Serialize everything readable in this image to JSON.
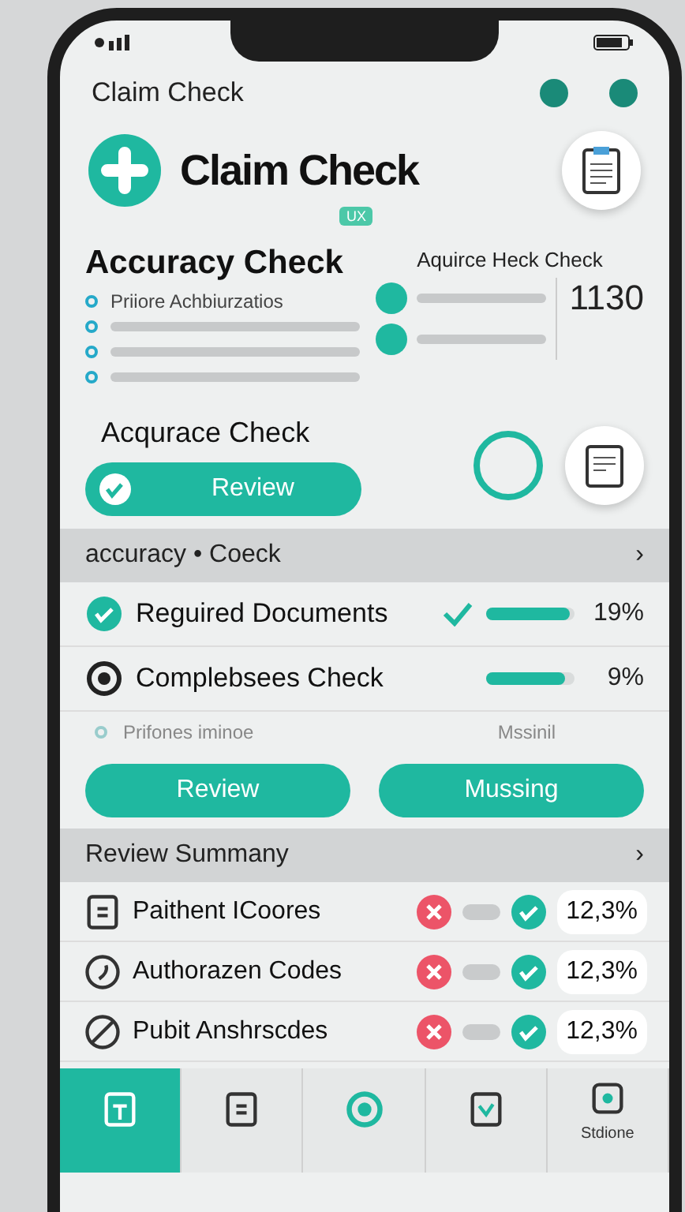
{
  "app_bar": {
    "title": "Claim Check"
  },
  "brand": {
    "title": "Claim Check",
    "tag": "UX"
  },
  "accuracy": {
    "title": "Accuracy Check",
    "items": [
      {
        "kind": "text",
        "label": "Priiore Achbiurzatios"
      },
      {
        "kind": "bar"
      },
      {
        "kind": "bar"
      },
      {
        "kind": "bar"
      }
    ]
  },
  "summary_card": {
    "title": "Aquirce Heck Check",
    "value": "1130"
  },
  "review_block": {
    "title": "Acqurace Check",
    "button": "Review"
  },
  "checks_section": {
    "title": "accuracy • Coeck",
    "chevron": "›",
    "rows": [
      {
        "kind": "done",
        "label": "Reguired Documents",
        "checked": true,
        "level": 0.95,
        "reading": "19%"
      },
      {
        "kind": "pending",
        "label": "Complebsees Check",
        "checked": false,
        "level": 0.9,
        "reading": "9%"
      }
    ],
    "note": {
      "label": "Prifones iminoe",
      "status": "Mssinil"
    },
    "buttons": [
      "Review",
      "Mussing"
    ]
  },
  "review_summary": {
    "title": "Review Summany",
    "chevron": "›",
    "rows": [
      {
        "label": "Paithent ICoores",
        "reading": "12,3%"
      },
      {
        "label": "Authorazen Codes",
        "reading": "12,3%"
      },
      {
        "label": "Pubit Anshrscdes",
        "reading": "12,3%"
      }
    ]
  },
  "tab_bar": [
    {
      "selected": true
    },
    {
      "selected": false
    },
    {
      "selected": false
    },
    {
      "selected": false
    },
    {
      "selected": false,
      "label": "Stdione"
    }
  ]
}
